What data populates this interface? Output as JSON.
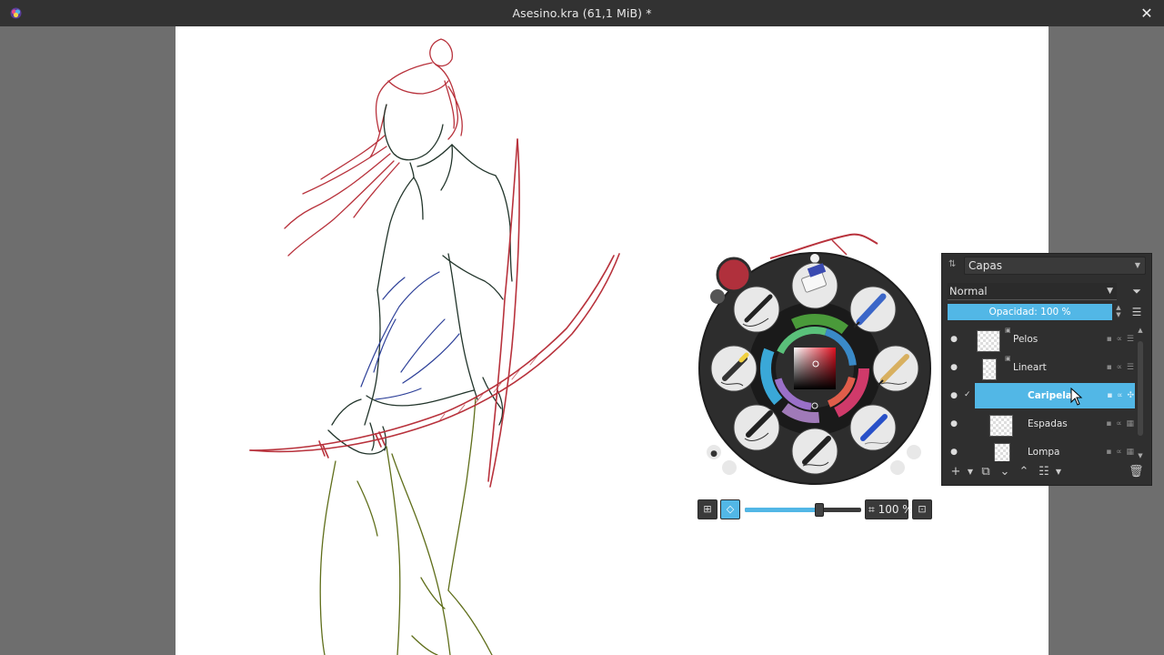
{
  "window": {
    "title": "Asesino.kra (61,1 MiB) *",
    "close_glyph": "✕"
  },
  "palette": {
    "zoom_value": "100 %",
    "rotation_fraction": 0.64,
    "accent_color": "#52b7e6",
    "current_color": "#c8202a"
  },
  "layers_docker": {
    "title": "Capas",
    "blend_mode": "Normal",
    "opacity_label": "Opacidad: 100 %",
    "layers": [
      {
        "name": "Pelos",
        "visible": true,
        "active": false
      },
      {
        "name": "Lineart",
        "visible": true,
        "active": false
      },
      {
        "name": "Caripela",
        "visible": true,
        "active": true
      },
      {
        "name": "Espadas",
        "visible": true,
        "active": false
      },
      {
        "name": "Lompa",
        "visible": true,
        "active": false
      }
    ],
    "toolbar_icons": [
      "add-layer-icon",
      "add-dropdown-icon",
      "duplicate-icon",
      "move-down-icon",
      "move-up-icon",
      "properties-icon",
      "properties-dropdown-icon",
      "delete-icon"
    ]
  }
}
